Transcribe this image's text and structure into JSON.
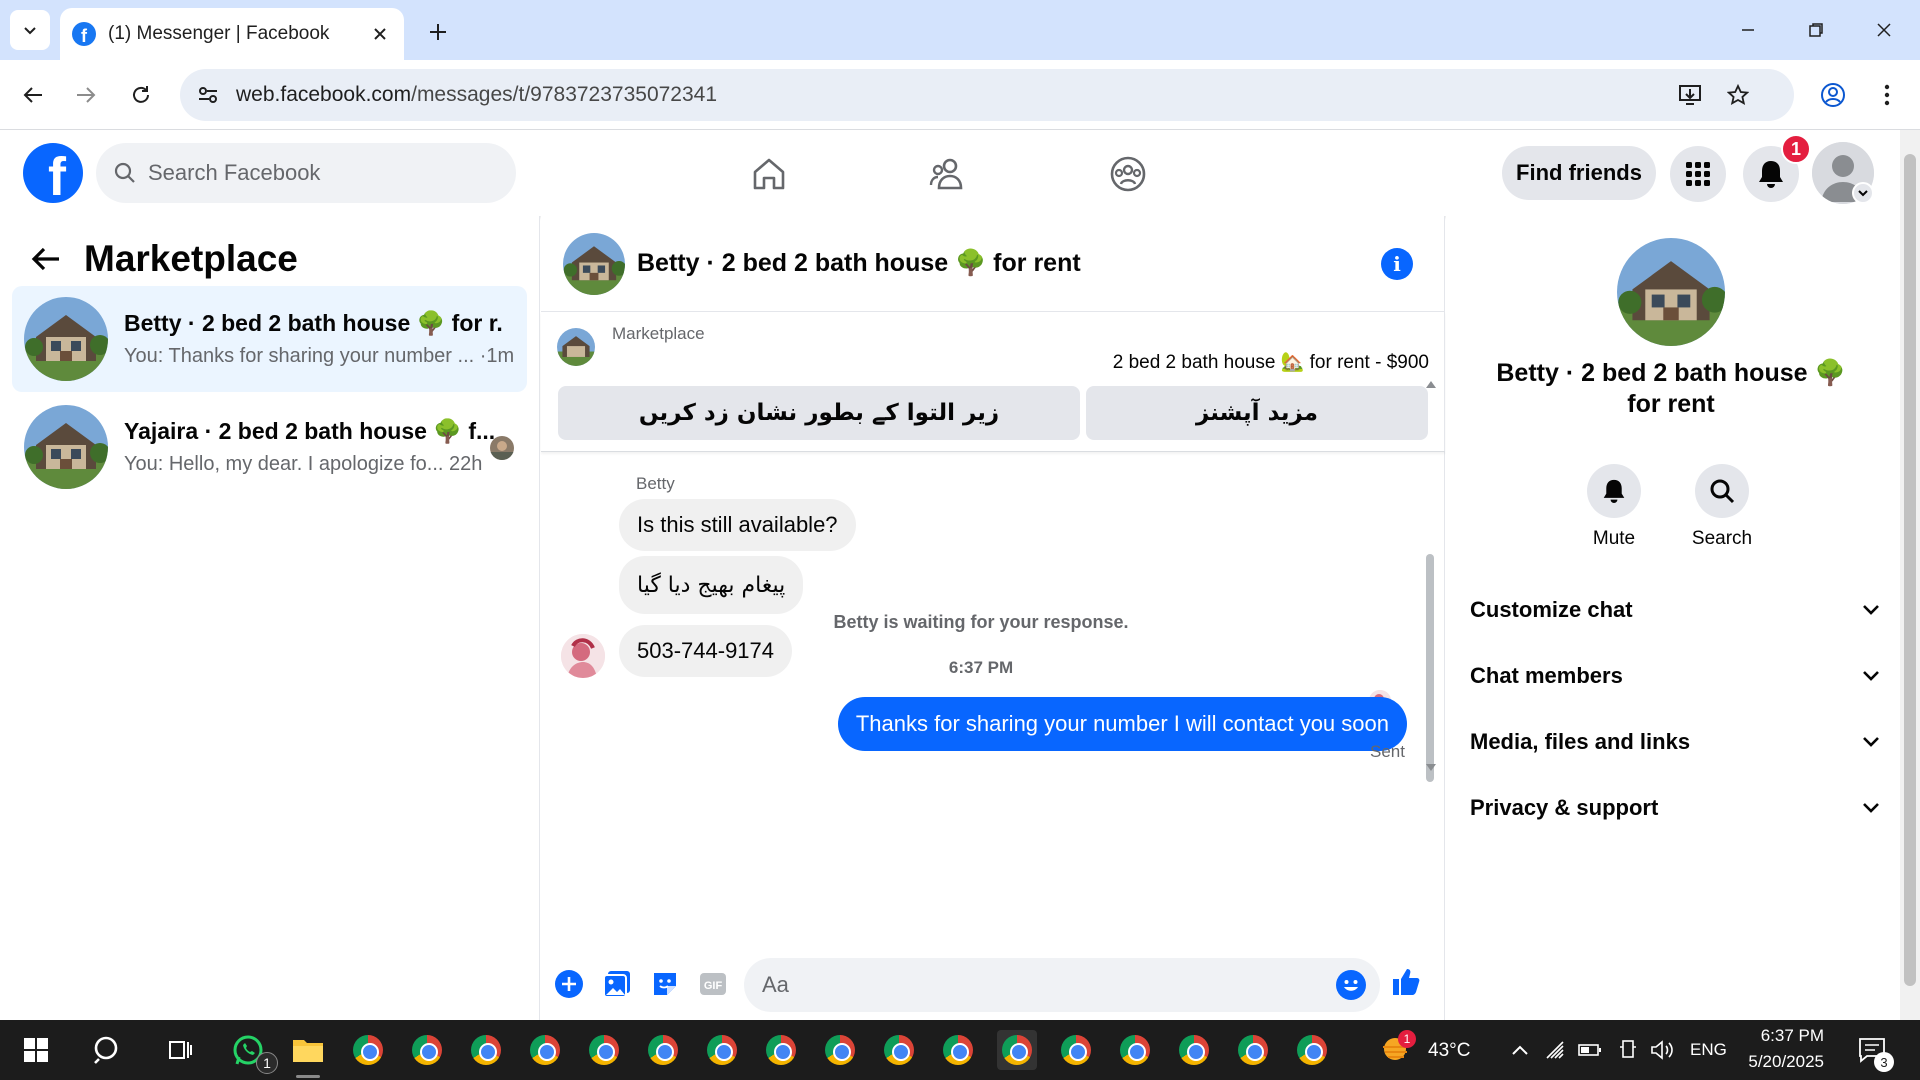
{
  "browser": {
    "tab_title": "(1) Messenger | Facebook",
    "url_host": "web.facebook.com",
    "url_path": "/messages/t/9783723735072341"
  },
  "fbnav": {
    "search_placeholder": "Search Facebook",
    "find_friends": "Find friends",
    "notification_count": "1"
  },
  "left": {
    "title": "Marketplace",
    "chats": [
      {
        "name": "Betty · 2 bed 2 bath house 🌳 for r...",
        "preview": "You: Thanks for sharing your number ... ·1m"
      },
      {
        "name": "Yajaira · 2 bed 2 bath house 🌳 f...",
        "preview": "You: Hello, my dear. I apologize fo...  22h"
      }
    ]
  },
  "conversation": {
    "title": "Betty · 2 bed 2 bath house 🌳 for rent",
    "banner_label": "Marketplace",
    "listing": "2 bed 2 bath house 🏡 for rent - $900",
    "btn_pending": "زیر التوا کے بطور نشان زد کریں",
    "btn_more": "مزید آپشنز",
    "sender": "Betty",
    "messages_in": [
      "Is this still available?",
      "پیغام بھیج دیا گیا",
      "503-744-9174"
    ],
    "waiting": "Betty is waiting for your response.",
    "time": "6:37 PM",
    "message_out": "Thanks for sharing your number I will contact you soon",
    "status": "Sent",
    "composer_placeholder": "Aa"
  },
  "right": {
    "title_line1": "Betty · 2 bed 2 bath house 🌳",
    "title_line2": "for rent",
    "mute": "Mute",
    "search": "Search",
    "sections": [
      "Customize chat",
      "Chat members",
      "Media, files and links",
      "Privacy & support"
    ]
  },
  "taskbar": {
    "whatsapp_badge": "1",
    "weather_badge": "1",
    "temperature": "43°C",
    "language": "ENG",
    "time": "6:37 PM",
    "date": "5/20/2025",
    "notif_count": "3"
  },
  "colors": {
    "fb_blue": "#0866ff",
    "badge_red": "#e41e3f",
    "tab_strip": "#d3e3fd"
  }
}
